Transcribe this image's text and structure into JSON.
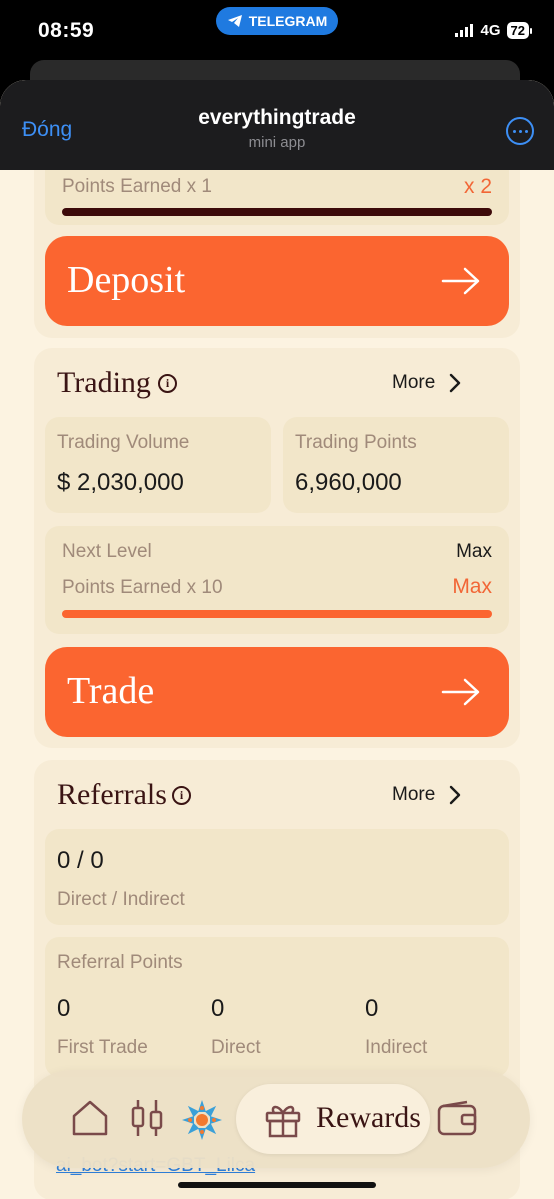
{
  "status": {
    "time": "08:59",
    "pill": "TELEGRAM",
    "network": "4G",
    "battery": "72"
  },
  "header": {
    "close": "Đóng",
    "title": "everythingtrade",
    "subtitle": "mini app"
  },
  "deposit_section": {
    "points_label": "Points Earned x 1",
    "points_value": "x 2",
    "button_label": "Deposit"
  },
  "trading": {
    "title": "Trading",
    "more": "More",
    "volume_label": "Trading Volume",
    "volume_value": "$ 2,030,000",
    "points_label": "Trading Points",
    "points_value": "6,960,000",
    "next_level_label": "Next Level",
    "next_level_value": "Max",
    "earned_label": "Points Earned x 10",
    "earned_value": "Max",
    "progress_fraction": 1.0,
    "button_label": "Trade"
  },
  "referrals": {
    "title": "Referrals",
    "more": "More",
    "count_value": "0 / 0",
    "count_label": "Direct / Indirect",
    "points_title": "Referral Points",
    "first_trade_value": "0",
    "first_trade_label": "First Trade",
    "direct_value": "0",
    "direct_label": "Direct",
    "indirect_value": "0",
    "indirect_label": "Indirect"
  },
  "bottom_nav": {
    "items": [
      "home-icon",
      "chart-icon",
      "sun-logo-icon",
      "gift-icon",
      "wallet-icon"
    ],
    "active_label": "Rewards"
  },
  "footer_link": "ai_bot?start=GBT_Lilca",
  "colors": {
    "accent": "#fb6530",
    "dark_bar": "#3d0a0a",
    "bg": "#fcf3e1"
  }
}
